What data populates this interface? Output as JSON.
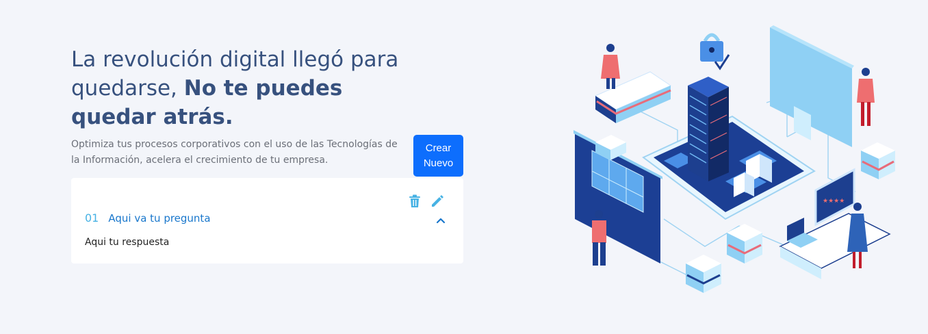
{
  "hero": {
    "title_light": "La revolución digital llegó para quedarse, ",
    "title_bold": "No te puedes quedar atrás.",
    "subtitle": "Optimiza tus procesos corporativos con el uso de las Tecnologías de la Información, acelera el crecimiento de tu empresa."
  },
  "actions": {
    "new_label": "Crear Nuevo"
  },
  "faq": {
    "number": "01",
    "question": "Aqui va tu pregunta",
    "answer": "Aqui tu respuesta",
    "icons": [
      "trash-icon",
      "pencil-icon",
      "chevron-up-icon"
    ]
  },
  "colors": {
    "background": "#f3f5fa",
    "title": "#37517e",
    "button": "#0d6efd",
    "accent": "#47b2e4",
    "question": "#1977cc"
  }
}
